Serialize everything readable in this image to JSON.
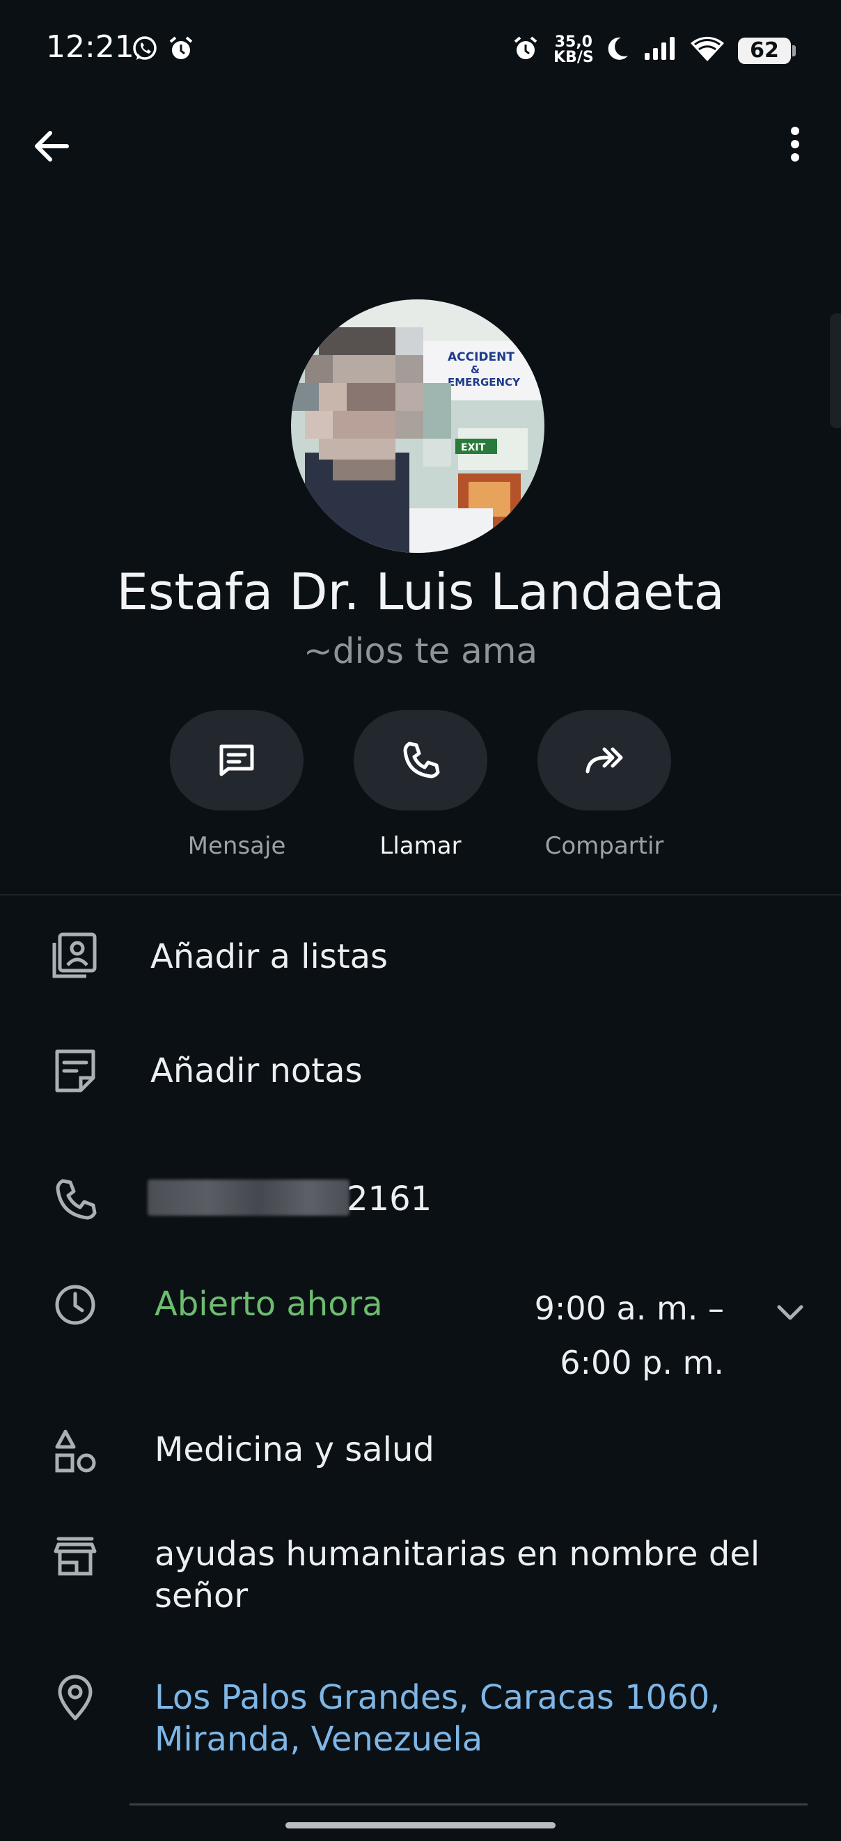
{
  "status_bar": {
    "time": "12:21",
    "net_speed_value": "35,0",
    "net_speed_unit": "KB/S",
    "battery": "62",
    "icons": [
      "whatsapp-icon",
      "alarm-icon",
      "alarm-icon",
      "moon-icon",
      "signal-icon",
      "wifi-icon",
      "battery-icon"
    ]
  },
  "toolbar": {
    "back_icon": "arrow-left-icon",
    "menu_icon": "more-vertical-icon"
  },
  "contact": {
    "name": "Estafa Dr. Luis Landaeta",
    "about": "~dios te ama",
    "avatar_signs": [
      "ACCIDENT",
      "&",
      "EMERGENCY",
      "EXIT"
    ]
  },
  "actions": [
    {
      "label": "Mensaje",
      "icon": "message-icon"
    },
    {
      "label": "Llamar",
      "icon": "phone-icon"
    },
    {
      "label": "Compartir",
      "icon": "share-icon"
    }
  ],
  "info": {
    "add_to_lists": "Añadir a listas",
    "add_notes": "Añadir notas",
    "phone_suffix": "2161",
    "open_status": "Abierto ahora",
    "hours_line1": "9:00 a. m. –",
    "hours_line2": "6:00 p. m.",
    "category": "Medicina y salud",
    "description_line1": "ayudas humanitarias en nombre del",
    "description_line2": "señor",
    "address_line1": "Los Palos Grandes, Caracas 1060,",
    "address_line2": "Miranda, Venezuela"
  },
  "colors": {
    "background": "#0b1015",
    "open_green": "#6cbd6e",
    "link_blue": "#7eb6e6",
    "button_bg": "#22282e"
  }
}
